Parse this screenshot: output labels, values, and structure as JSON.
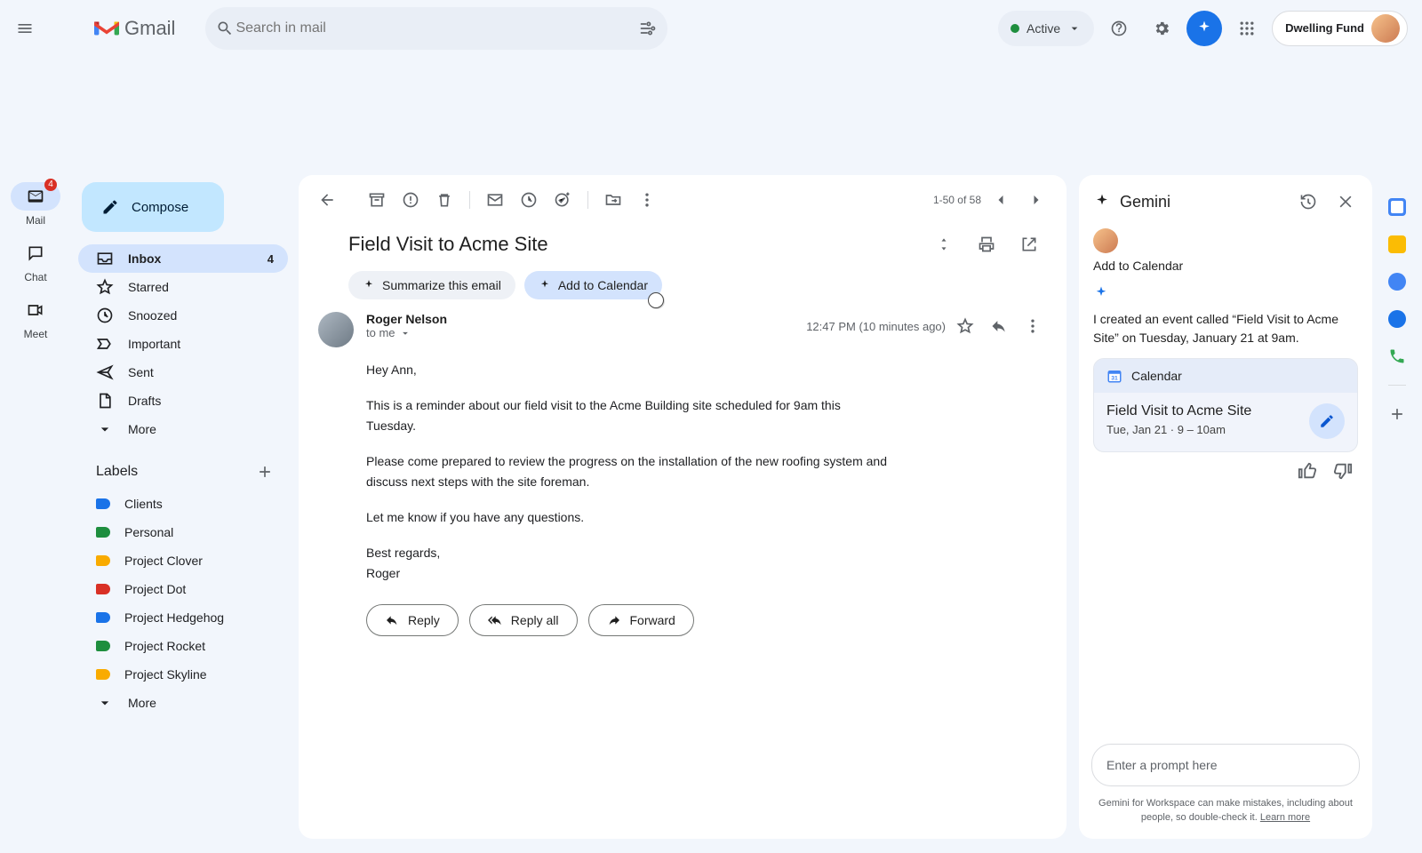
{
  "header": {
    "product": "Gmail",
    "search_placeholder": "Search in mail",
    "status": "Active",
    "org": "Dwelling Fund"
  },
  "rail": {
    "items": [
      {
        "label": "Mail",
        "badge": "4"
      },
      {
        "label": "Chat"
      },
      {
        "label": "Meet"
      }
    ]
  },
  "sidebar": {
    "compose": "Compose",
    "folders": [
      {
        "label": "Inbox",
        "count": "4",
        "active": true,
        "icon": "inbox"
      },
      {
        "label": "Starred",
        "icon": "star"
      },
      {
        "label": "Snoozed",
        "icon": "clock"
      },
      {
        "label": "Important",
        "icon": "important"
      },
      {
        "label": "Sent",
        "icon": "send"
      },
      {
        "label": "Drafts",
        "icon": "draft"
      },
      {
        "label": "More",
        "icon": "down"
      }
    ],
    "labels_header": "Labels",
    "labels": [
      {
        "label": "Clients",
        "color": "#1a73e8"
      },
      {
        "label": "Personal",
        "color": "#1e8e3e"
      },
      {
        "label": "Project Clover",
        "color": "#f9ab00"
      },
      {
        "label": "Project Dot",
        "color": "#d93025"
      },
      {
        "label": "Project Hedgehog",
        "color": "#1a73e8"
      },
      {
        "label": "Project Rocket",
        "color": "#1e8e3e"
      },
      {
        "label": "Project Skyline",
        "color": "#f9ab00"
      },
      {
        "label": "More",
        "color": ""
      }
    ]
  },
  "message": {
    "page_range": "1-50 of 58",
    "subject": "Field Visit to Acme Site",
    "chip_summarize": "Summarize this email",
    "chip_calendar": "Add to Calendar",
    "sender": "Roger Nelson",
    "to": "to me",
    "time": "12:47 PM (10 minutes ago)",
    "body": {
      "p1": "Hey Ann,",
      "p2": "This is a reminder about our field visit to the Acme Building site scheduled for 9am this Tuesday.",
      "p3": "Please come prepared to review the progress on the installation of the new roofing system and discuss next steps with the site foreman.",
      "p4": "Let me know if you have any questions.",
      "p5": "Best regards,",
      "p6": "Roger"
    },
    "reply": "Reply",
    "replyall": "Reply all",
    "forward": "Forward"
  },
  "gemini": {
    "title": "Gemini",
    "user_msg": "Add to Calendar",
    "reply": "I created an event called “Field Visit to Acme Site” on Tuesday, January 21 at 9am.",
    "card": {
      "app": "Calendar",
      "title": "Field Visit to Acme Site",
      "sub": "Tue, Jan 21 · 9 – 10am"
    },
    "prompt_placeholder": "Enter a prompt here",
    "disclaimer": "Gemini for Workspace can make mistakes, including about people, so double-check it. ",
    "learn": "Learn more"
  }
}
